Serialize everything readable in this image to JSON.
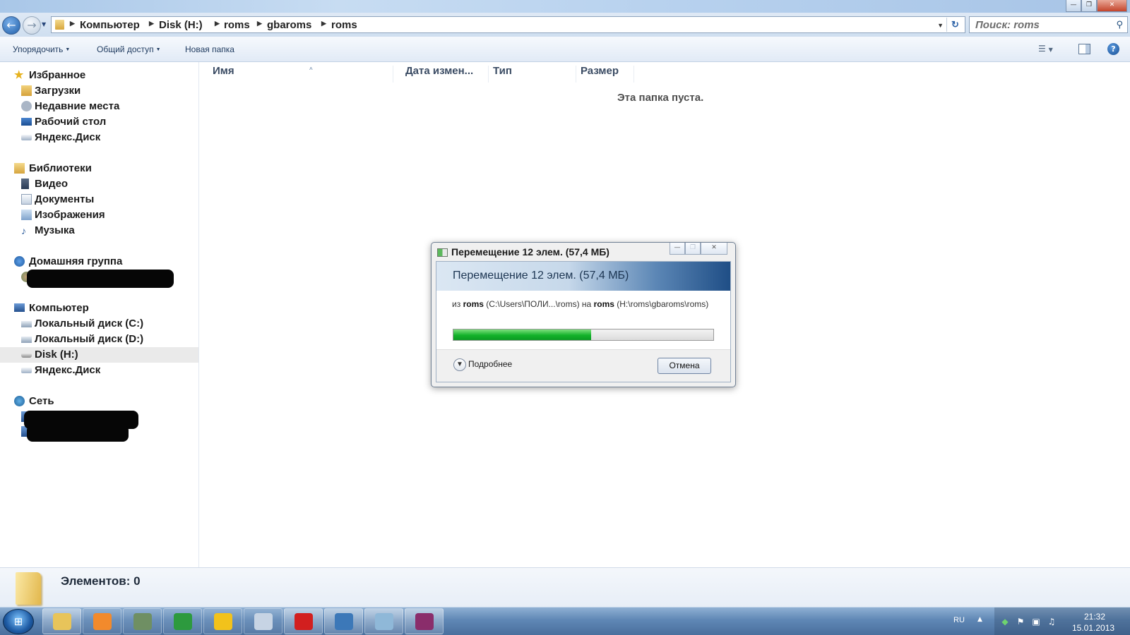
{
  "window": {
    "minimize_label": "—",
    "maximize_label": "❐",
    "close_label": "✕"
  },
  "address": {
    "breadcrumbs": [
      "Компьютер",
      "Disk (H:)",
      "roms",
      "gbaroms",
      "roms"
    ],
    "search_placeholder": "Поиск: roms"
  },
  "toolbar": {
    "organize": "Упорядочить",
    "share": "Общий доступ",
    "new_folder": "Новая папка"
  },
  "nav": {
    "favorites": {
      "label": "Избранное",
      "items": [
        "Загрузки",
        "Недавние места",
        "Рабочий стол",
        "Яндекс.Диск"
      ]
    },
    "libraries": {
      "label": "Библиотеки",
      "items": [
        "Видео",
        "Документы",
        "Изображения",
        "Музыка"
      ]
    },
    "homegroup": {
      "label": "Домашняя группа"
    },
    "computer": {
      "label": "Компьютер",
      "items": [
        "Локальный диск (C:)",
        "Локальный диск (D:)",
        "Disk (H:)",
        "Яндекс.Диск"
      ],
      "selected": "Disk (H:)"
    },
    "network": {
      "label": "Сеть"
    }
  },
  "content": {
    "columns": [
      "Имя",
      "Дата измен...",
      "Тип",
      "Размер"
    ],
    "empty_message": "Эта папка пуста."
  },
  "details": {
    "items_count": "Элементов: 0"
  },
  "dialog": {
    "title": "Перемещение 12 элем. (57,4 МБ)",
    "heading": "Перемещение 12 элем. (57,4 МБ)",
    "from_prefix": "из",
    "from_name": "roms",
    "from_path": "(C:\\Users\\ПОЛИ...\\roms)",
    "to_prefix": "на",
    "to_name": "roms",
    "to_path": "(H:\\roms\\gbaroms\\roms)",
    "progress": 0.53,
    "details_toggle": "Подробнее",
    "cancel": "Отмена"
  },
  "taskbar": {
    "apps": [
      {
        "icon": "explorer-icon",
        "color": "#e8c45a",
        "active": true
      },
      {
        "icon": "media-player-icon",
        "color": "#f28a2c",
        "active": false
      },
      {
        "icon": "monitor-icon",
        "color": "#6f8f63",
        "active": false
      },
      {
        "icon": "chrome-icon",
        "color": "#2d9a3e",
        "active": false
      },
      {
        "icon": "v-app-icon",
        "color": "#f2c21b",
        "active": false
      },
      {
        "icon": "calculator-icon",
        "color": "#c7d4e4",
        "active": false
      },
      {
        "icon": "opera-icon",
        "color": "#d21f1f",
        "active": true
      },
      {
        "icon": "image-viewer-icon",
        "color": "#3c78b8",
        "active": true
      },
      {
        "icon": "copy-progress-icon",
        "color": "#8fb8d8",
        "active": true
      },
      {
        "icon": "winrar-icon",
        "color": "#8a2d6b",
        "active": true
      }
    ],
    "language": "RU",
    "time": "21:32",
    "date": "15.01.2013"
  }
}
